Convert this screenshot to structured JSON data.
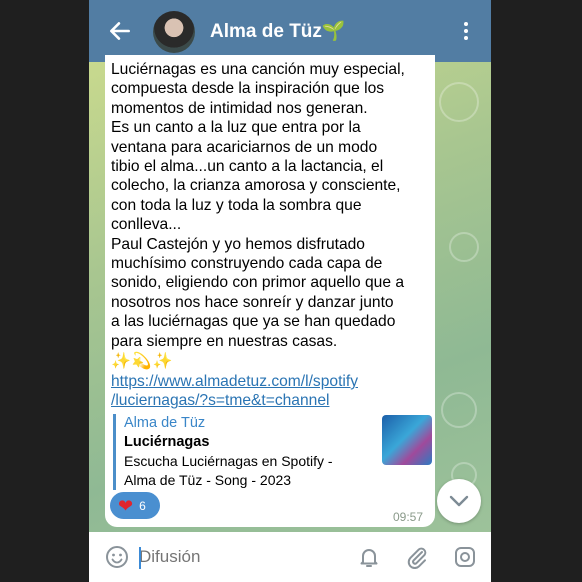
{
  "header": {
    "title": "Alma de Tüz",
    "title_emoji": "🌱",
    "back_icon": "arrow-left-icon",
    "menu_icon": "more-vertical-icon"
  },
  "message": {
    "text": "Luciérnagas es una canción muy especial,\ncompuesta desde la inspiración que los\nmomentos de intimidad nos generan.\nEs un canto a la luz que entra por la\nventana para acariciarnos de un modo\ntibio el alma...un canto a la lactancia, el\ncolecho, la crianza amorosa y consciente,\ncon toda la luz y toda la sombra que\nconlleva...\nPaul Castejón y yo hemos disfrutado\nmuchísimo construyendo cada capa de\nsonido, eligiendo con primor aquello que a\nnosotros nos hace sonreír y danzar junto\na las luciérnagas que ya se han quedado\npara siempre en nuestras casas.",
    "emojis": "✨💫✨",
    "link": "https://www.almadetuz.com/l/spotify\n/luciernagas/?s=tme&t=channel",
    "preview": {
      "site": "Alma de Tüz",
      "title": "Luciérnagas",
      "description": "Escucha Luciérnagas en Spotify - Alma de Tüz - Song - 2023"
    },
    "reaction": {
      "emoji": "❤",
      "count": "6"
    },
    "time": "09:57"
  },
  "input": {
    "placeholder": "Difusión"
  },
  "colors": {
    "header": "#527da3",
    "link": "#2a74b3",
    "reaction": "#4a8fd0"
  }
}
